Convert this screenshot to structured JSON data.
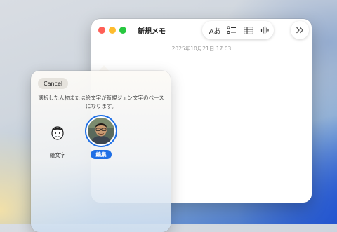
{
  "note_window": {
    "title": "新規メモ",
    "date": "2025年10月21日 17:03",
    "toolbar": {
      "format_label": "Aあ",
      "icons": [
        "checklist-icon",
        "table-icon",
        "audio-waveform-icon",
        "more-chevrons-icon"
      ]
    }
  },
  "popover": {
    "cancel_label": "Cancel",
    "message": "選択した人物または絵文字が新規ジェン文字のベースになります。",
    "options": {
      "emoji_label": "絵文字",
      "photo_badge": "編集"
    }
  },
  "colors": {
    "accent": "#1f6fe5",
    "close": "#ff5f57",
    "minimize": "#febc2e",
    "maximize": "#28c840"
  }
}
